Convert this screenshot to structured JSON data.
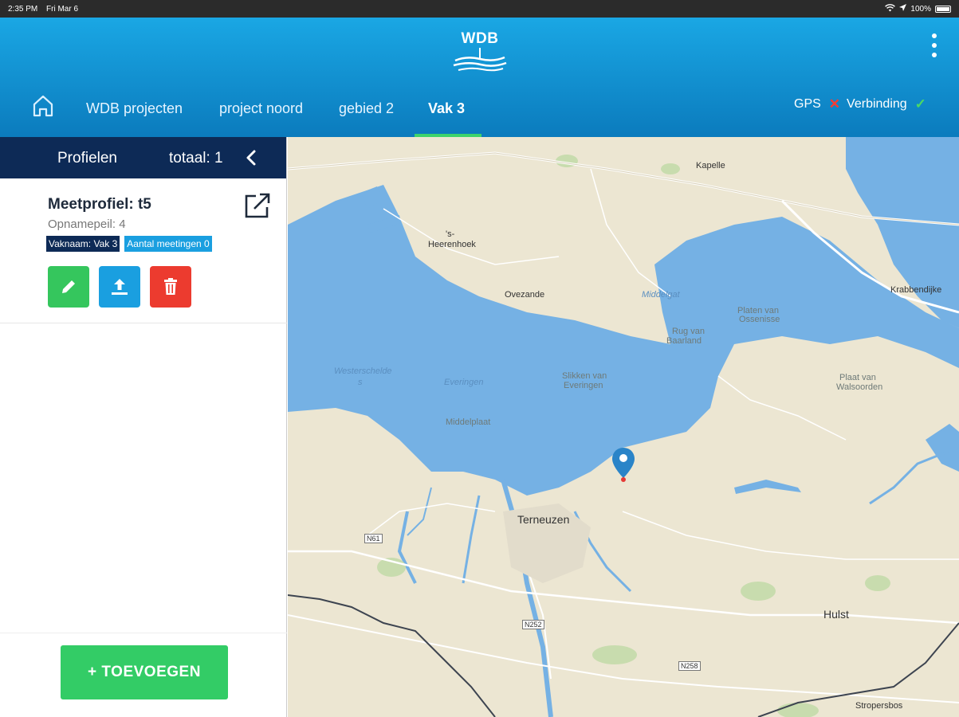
{
  "status_bar": {
    "time": "2:35 PM",
    "date": "Fri Mar 6",
    "battery": "100%"
  },
  "app": {
    "logo_text": "WDB"
  },
  "breadcrumbs": [
    {
      "label": "WDB projecten"
    },
    {
      "label": "project noord"
    },
    {
      "label": "gebied 2"
    },
    {
      "label": "Vak 3"
    }
  ],
  "connection": {
    "gps_label": "GPS",
    "gps_state": "off",
    "link_label": "Verbinding",
    "link_state": "on"
  },
  "sidebar": {
    "title": "Profielen",
    "total": "totaal: 1",
    "items": [
      {
        "title": "Meetprofiel: t5",
        "subtitle": "Opnamepeil: 4",
        "badge_vak": "Vaknaam: Vak 3",
        "badge_meetingen": "Aantal meetingen 0"
      }
    ],
    "add_button": "+ TOEVOEGEN"
  },
  "map": {
    "labels": {
      "kapelle": "Kapelle",
      "heerenhoek_1": "'s-",
      "heerenhoek_2": "Heerenhoek",
      "ovezande": "Ovezande",
      "krabbendijke": "Krabbendijke",
      "middelgat": "Middelgat",
      "platen_1": "Platen van",
      "platen_2": "Ossenisse",
      "rug_1": "Rug van",
      "rug_2": "Baarland",
      "westerschelde_1": "Westerschelde",
      "westerschelde_2": "s",
      "everingen": "Everingen",
      "slikken_1": "Slikken van",
      "slikken_2": "Everingen",
      "middelplaat": "Middelplaat",
      "plaat_1": "Plaat van",
      "plaat_2": "Walsoorden",
      "terneuzen": "Terneuzen",
      "hulst": "Hulst",
      "stropersbos": "Stropersbos",
      "n61": "N61",
      "n252": "N252",
      "n258": "N258"
    },
    "colors": {
      "water": "#75b1e4",
      "land": "#ece6d2",
      "park": "#c8dcae"
    }
  },
  "colors": {
    "header_top": "#1aa7e4",
    "header_bottom": "#0b7bbd",
    "nav_dark": "#0d2a56",
    "accent_green": "#3dd36b",
    "error_red": "#ec3b2f",
    "info_blue": "#1a9fe0"
  }
}
